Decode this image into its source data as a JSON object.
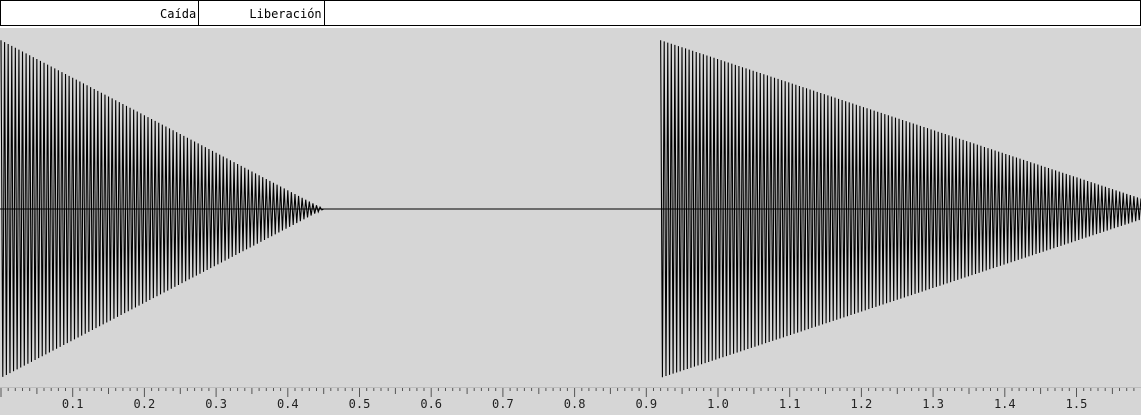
{
  "label_track": {
    "regions": [
      {
        "label": "Caída",
        "start": 0.0,
        "end": 0.275
      },
      {
        "label": "Liberación",
        "start": 0.275,
        "end": 0.45
      }
    ]
  },
  "waveform": {
    "color": "#000000",
    "background": "#d6d6d6",
    "segments": [
      {
        "start": 0.0,
        "end": 0.45,
        "amplitude_start": 0.97,
        "amplitude_end": 0.0,
        "cycles": 90
      },
      {
        "start": 0.92,
        "end": 1.59,
        "amplitude_start": 0.97,
        "amplitude_end": 0.06,
        "cycles": 135
      }
    ]
  },
  "timeline": {
    "x_start": 0.0,
    "x_end": 1.59,
    "ticks": [
      "0.1",
      "0.2",
      "0.3",
      "0.4",
      "0.5",
      "0.6",
      "0.7",
      "0.8",
      "0.9",
      "1.0",
      "1.1",
      "1.2",
      "1.3",
      "1.4",
      "1.5"
    ]
  }
}
